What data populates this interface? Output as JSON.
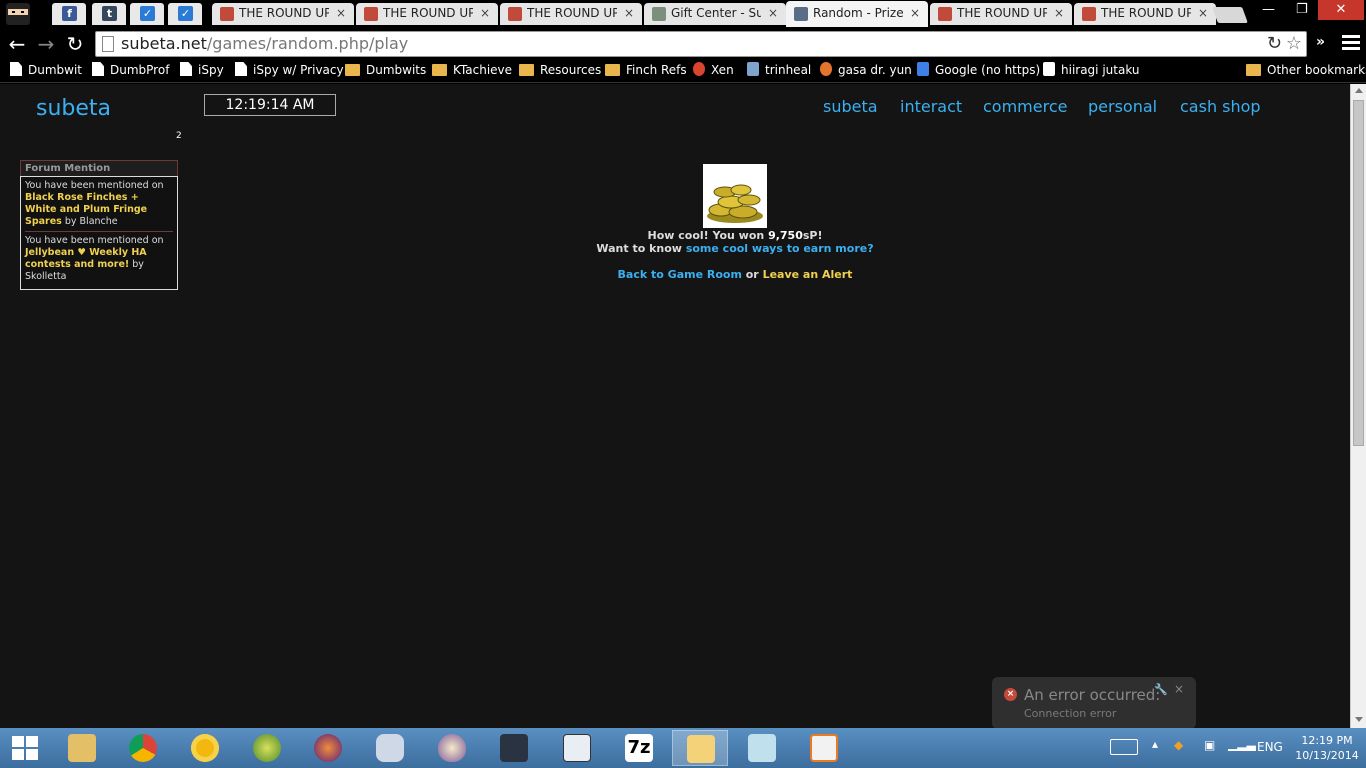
{
  "browser": {
    "pinned_tabs": [
      {
        "icon": "ninja-avatar-icon"
      },
      {
        "icon": "facebook-icon",
        "glyph": "f",
        "color": "#3b5998"
      },
      {
        "icon": "tumblr-icon",
        "glyph": "t",
        "color": "#36465d"
      },
      {
        "icon": "check-icon",
        "glyph": "✓",
        "color": "#2b7bd6"
      },
      {
        "icon": "check-icon",
        "glyph": "✓",
        "color": "#2b7bd6"
      }
    ],
    "tabs": [
      {
        "label": "THE ROUND UP",
        "close": "×",
        "active": false
      },
      {
        "label": "THE ROUND UP",
        "close": "×",
        "active": false
      },
      {
        "label": "THE ROUND UP",
        "close": "×",
        "active": false
      },
      {
        "label": "Gift Center - Sub",
        "close": "×",
        "active": false
      },
      {
        "label": "Random - Prize",
        "close": "×",
        "active": true
      },
      {
        "label": "THE ROUND UP",
        "close": "×",
        "active": false
      },
      {
        "label": "THE ROUND UP",
        "close": "×",
        "active": false
      }
    ],
    "window_controls": {
      "minimize": "—",
      "maximize": "❐",
      "close": "✕"
    },
    "nav": {
      "back": "←",
      "forward": "→",
      "reload": "↻"
    },
    "url_host": "subeta.net",
    "url_path": "/games/random.php/play",
    "reload_inline": "↻",
    "star": "☆",
    "ext_more": "»",
    "bookmarks": [
      {
        "label": "Dumbwit",
        "icon": "page"
      },
      {
        "label": "DumbProf",
        "icon": "page"
      },
      {
        "label": "iSpy",
        "icon": "page"
      },
      {
        "label": "iSpy w/ Privacy",
        "icon": "page"
      },
      {
        "label": "Dumbwits",
        "icon": "folder"
      },
      {
        "label": "KTachieve",
        "icon": "folder"
      },
      {
        "label": "Resources",
        "icon": "folder"
      },
      {
        "label": "Finch Refs",
        "icon": "folder"
      },
      {
        "label": "Xen",
        "icon": "red"
      },
      {
        "label": "trinheal",
        "icon": "blue"
      },
      {
        "label": "gasa dr. yun",
        "icon": "orange"
      },
      {
        "label": "Google (no https)",
        "icon": "google"
      },
      {
        "label": "hiiragi jutaku",
        "icon": "cbox"
      }
    ],
    "other_bookmarks": "Other bookmarks"
  },
  "site": {
    "logo": "subeta",
    "clock": "12:19:14 AM",
    "notification_count": "2",
    "nav": [
      "subeta",
      "interact",
      "commerce",
      "personal",
      "cash shop"
    ]
  },
  "forum_mention": {
    "title": "Forum Mention",
    "items": [
      {
        "prefix": "You have been mentioned on ",
        "thread": "Black Rose Finches + White and Plum Fringe Spares",
        "by": " by Blanche"
      },
      {
        "prefix": "You have been mentioned on ",
        "thread": "Jellybean ♥ Weekly HA contests and more!",
        "by": " by Skolletta"
      }
    ]
  },
  "prize": {
    "image_alt": "pile-of-gold-coins",
    "won_prefix": "How cool! You won ",
    "amount": "9,750",
    "currency": "sP!",
    "earn_prefix": "Want to know ",
    "earn_link": "some cool ways to earn more?",
    "back_link": "Back to Game Room",
    "or_text": " or ",
    "alert_link": "Leave an Alert"
  },
  "error_toast": {
    "title": "An error occurred:",
    "subtitle": "Connection error",
    "close": "×",
    "wrench": "🔧"
  },
  "taskbar": {
    "language": "ENG",
    "time": "12:19 PM",
    "date": "10/13/2014",
    "seven_zip_label": "7z"
  }
}
